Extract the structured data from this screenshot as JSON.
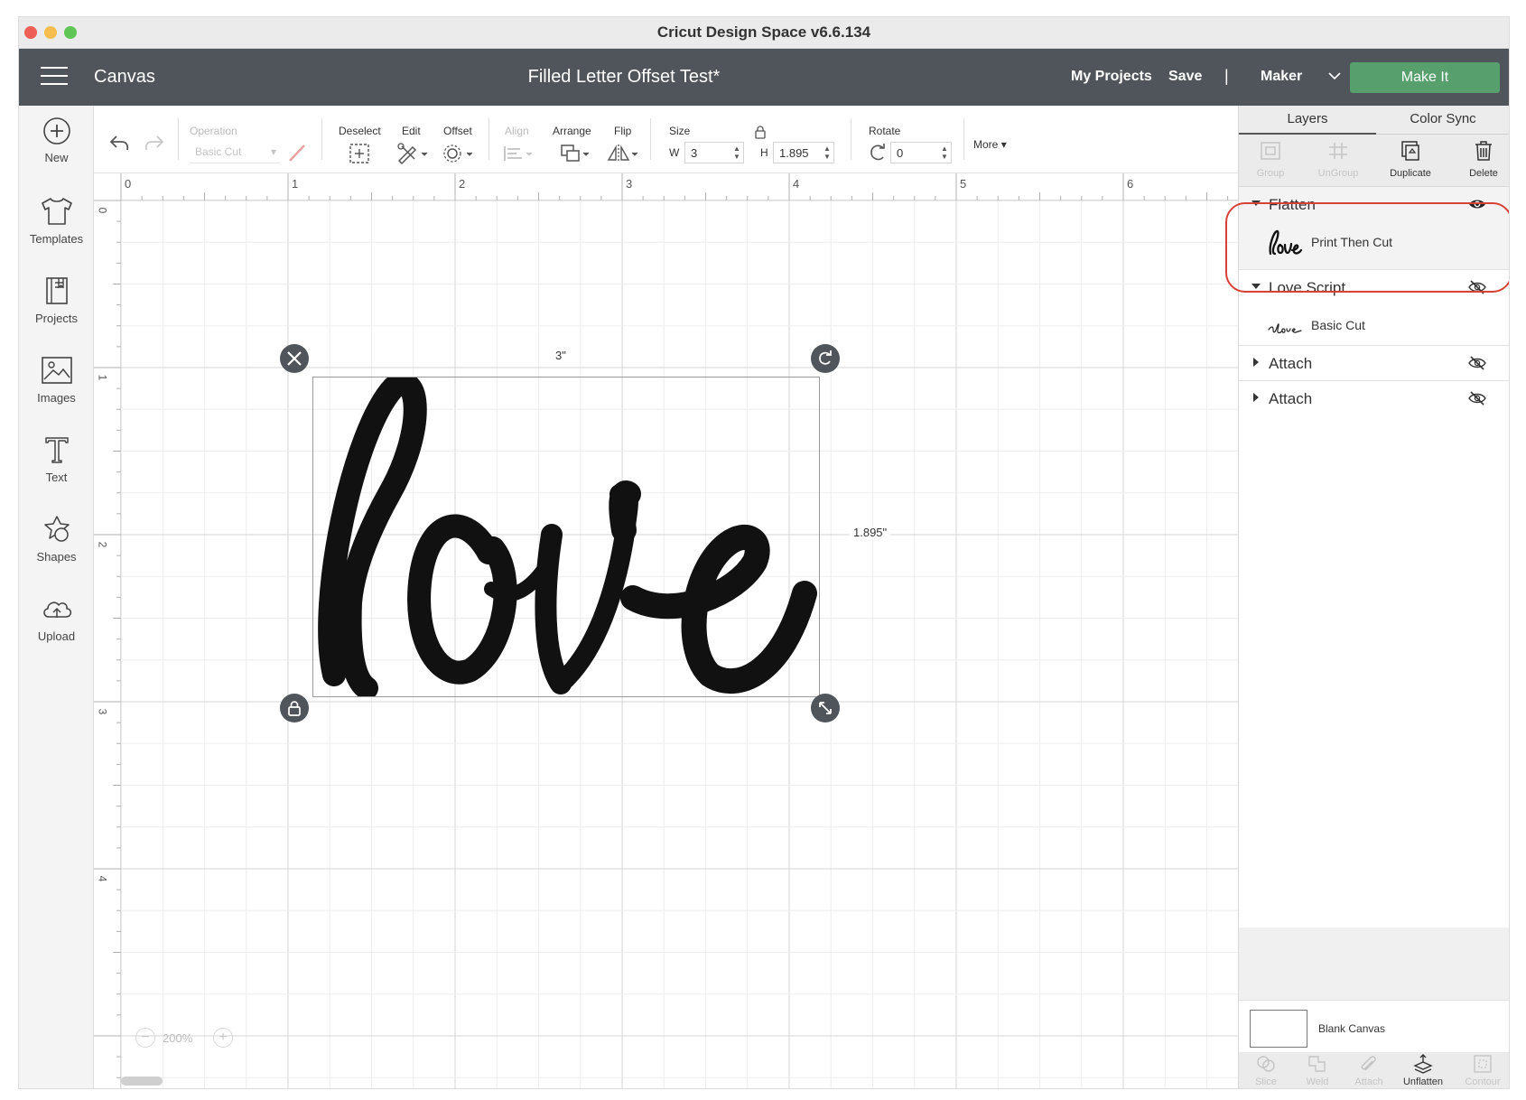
{
  "window": {
    "title": "Cricut Design Space  v6.6.134"
  },
  "header": {
    "section": "Canvas",
    "project_name": "Filled Letter Offset Test*",
    "my_projects": "My Projects",
    "save": "Save",
    "separator": "|",
    "machine": "Maker",
    "make_it": "Make It"
  },
  "sidebar": {
    "items": [
      {
        "label": "New",
        "icon": "plus-circle-icon"
      },
      {
        "label": "Templates",
        "icon": "tshirt-icon"
      },
      {
        "label": "Projects",
        "icon": "projects-icon"
      },
      {
        "label": "Images",
        "icon": "image-icon"
      },
      {
        "label": "Text",
        "icon": "text-icon"
      },
      {
        "label": "Shapes",
        "icon": "shapes-icon"
      },
      {
        "label": "Upload",
        "icon": "upload-cloud-icon"
      }
    ]
  },
  "toolbar": {
    "operation_label": "Operation",
    "operation_value": "Basic Cut",
    "deselect_label": "Deselect",
    "edit_label": "Edit",
    "offset_label": "Offset",
    "align_label": "Align",
    "arrange_label": "Arrange",
    "flip_label": "Flip",
    "size_label": "Size",
    "w_label": "W",
    "w_value": "3",
    "h_label": "H",
    "h_value": "1.895",
    "rotate_label": "Rotate",
    "rotate_value": "0",
    "more_label": "More"
  },
  "rulers": {
    "horizontal": [
      "0",
      "1",
      "2",
      "3",
      "4",
      "5",
      "6"
    ],
    "vertical": [
      "0",
      "1",
      "2",
      "3",
      "4"
    ]
  },
  "canvas": {
    "zoom_level": "200%",
    "width_dimension": "3\"",
    "height_dimension": "1.895\""
  },
  "panel": {
    "tabs": [
      "Layers",
      "Color Sync"
    ],
    "actions": [
      {
        "label": "Group",
        "enabled": false
      },
      {
        "label": "UnGroup",
        "enabled": false
      },
      {
        "label": "Duplicate",
        "enabled": true
      },
      {
        "label": "Delete",
        "enabled": true
      }
    ],
    "layers": [
      {
        "name": "Flatten",
        "expanded": true,
        "visible": true,
        "child": {
          "name": "Print Then Cut"
        }
      },
      {
        "name": "Love Script",
        "expanded": true,
        "visible": false,
        "child": {
          "name": "Basic Cut"
        }
      },
      {
        "name": "Attach",
        "expanded": false,
        "visible": false
      },
      {
        "name": "Attach",
        "expanded": false,
        "visible": false
      }
    ],
    "canvas_label": "Blank Canvas",
    "bottom_actions": [
      {
        "label": "Slice",
        "enabled": false
      },
      {
        "label": "Weld",
        "enabled": false
      },
      {
        "label": "Attach",
        "enabled": false
      },
      {
        "label": "Unflatten",
        "enabled": true
      },
      {
        "label": "Contour",
        "enabled": false
      }
    ]
  },
  "colors": {
    "header_bg": "#4f555b",
    "make_it_green": "#57a06e",
    "highlight_red": "#d94136"
  }
}
